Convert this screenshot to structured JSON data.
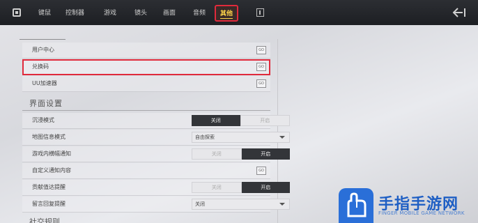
{
  "topbar": {
    "tabs": [
      {
        "label": "键鼠"
      },
      {
        "label": "控制器"
      },
      {
        "label": "游戏"
      },
      {
        "label": "镜头"
      },
      {
        "label": "画面"
      },
      {
        "label": "音频"
      },
      {
        "label": "其他",
        "active": true
      }
    ],
    "active_tab_color": "#ffd54a",
    "highlight_color": "#e02a3c"
  },
  "account_rows": [
    {
      "label": "用户中心",
      "button": "GO"
    },
    {
      "label": "兑换码",
      "button": "GO",
      "highlighted": true
    },
    {
      "label": "UU加速器",
      "button": "GO"
    }
  ],
  "interface_section": {
    "title": "界面设置",
    "rows": [
      {
        "label": "沉浸模式",
        "type": "segmented",
        "options": [
          "关闭",
          "开启"
        ],
        "selected": "关闭"
      },
      {
        "label": "地图信息模式",
        "type": "select",
        "value": "自由探索"
      },
      {
        "label": "游戏内横幅通知",
        "type": "segmented",
        "options": [
          "关闭",
          "开启"
        ],
        "selected": "开启"
      },
      {
        "label": "自定义通知内容",
        "type": "button",
        "button": "GO"
      },
      {
        "label": "贡献值达提醒",
        "type": "segmented",
        "options": [
          "关闭",
          "开启"
        ],
        "selected": "开启"
      },
      {
        "label": "留言回复提醒",
        "type": "select",
        "value": "关闭"
      }
    ]
  },
  "bottom_section": {
    "title": "社交规则"
  },
  "watermark": {
    "title": "手指手游网",
    "subtitle": "FINGER MOBILE GAME NETWORK",
    "color": "#2a6fd8"
  }
}
